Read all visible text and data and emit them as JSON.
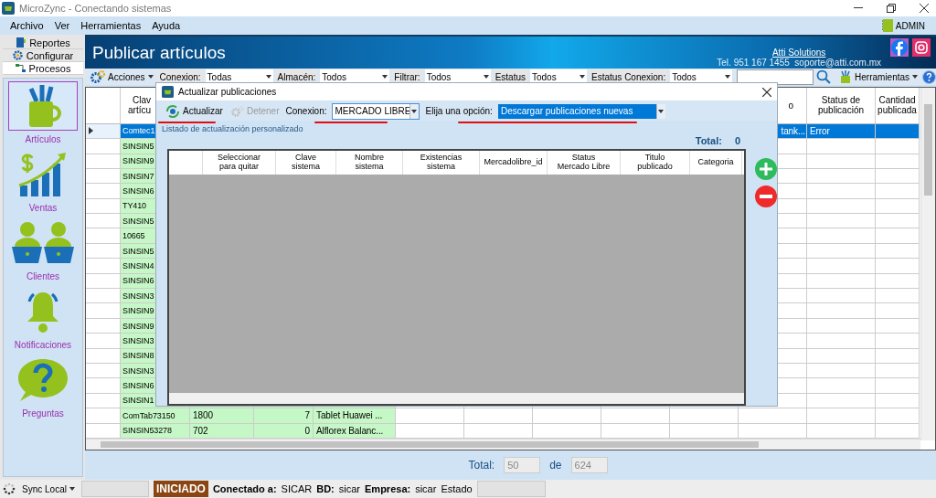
{
  "window": {
    "title": "MicroZync - Conectando sistemas"
  },
  "menu": [
    {
      "label": "Archivo"
    },
    {
      "label": "Ver"
    },
    {
      "label": "Herramientas"
    },
    {
      "label": "Ayuda"
    }
  ],
  "user": {
    "name": "ADMIN"
  },
  "sidebar": {
    "tabs": [
      {
        "label": "Reportes",
        "kind": "book",
        "selected": false
      },
      {
        "label": "Configurar",
        "kind": "gear",
        "selected": false
      },
      {
        "label": "Procesos",
        "kind": "flow",
        "selected": true
      }
    ],
    "items": [
      {
        "label": "Artículos",
        "kind": "supplies",
        "selected": true
      },
      {
        "label": "Ventas",
        "kind": "chart",
        "selected": false
      },
      {
        "label": "Clientes",
        "kind": "people",
        "selected": false
      },
      {
        "label": "Notificaciones",
        "kind": "bell",
        "selected": false
      },
      {
        "label": "Preguntas",
        "kind": "question",
        "selected": false
      }
    ]
  },
  "header": {
    "title": "Publicar artículos",
    "company": "Atti Solutions",
    "contact": "Tel. 951 167 1455  soporte@atti.com.mx"
  },
  "toolbar": {
    "actions": "Acciones",
    "filters": [
      {
        "label": "Conexion:",
        "value": "Todas"
      },
      {
        "label": "Almacén:",
        "value": "Todos"
      },
      {
        "label": "Filtrar:",
        "value": "Todos"
      },
      {
        "label": "Estatus",
        "value": "Todos"
      },
      {
        "label": "Estatus Conexion:",
        "value": "Todos"
      }
    ],
    "tools": "Herramientas"
  },
  "table": {
    "columns": {
      "clave": "Clav\nartícu",
      "column_10": "o",
      "status": "Status de\npublicación",
      "quantity": "Cantidad\npublicada"
    },
    "rows": [
      {
        "selected": true,
        "clave": "Comtec1",
        "column_10": "tank...",
        "status": "Error"
      },
      {
        "selected": false,
        "clave": "SINSIN5"
      },
      {
        "selected": false,
        "clave": "SINSIN9"
      },
      {
        "selected": false,
        "clave": "SINSIN7"
      },
      {
        "selected": false,
        "clave": "SINSIN6"
      },
      {
        "selected": false,
        "clave": "TY410"
      },
      {
        "selected": false,
        "clave": "SINSIN5"
      },
      {
        "selected": false,
        "clave": "10665"
      },
      {
        "selected": false,
        "clave": "SINSIN5"
      },
      {
        "selected": false,
        "clave": "SINSIN4"
      },
      {
        "selected": false,
        "clave": "SINSIN6"
      },
      {
        "selected": false,
        "clave": "SINSIN3"
      },
      {
        "selected": false,
        "clave": "SINSIN9"
      },
      {
        "selected": false,
        "clave": "SINSIN9"
      },
      {
        "selected": false,
        "clave": "SINSIN3"
      },
      {
        "selected": false,
        "clave": "SINSIN8"
      },
      {
        "selected": false,
        "clave": "SINSIN3"
      },
      {
        "selected": false,
        "clave": "SINSIN6"
      },
      {
        "selected": false,
        "clave": "SINSIN1"
      },
      {
        "selected": false,
        "clave": "ComTab73150",
        "column_2": "1800",
        "column_3": "7",
        "column_4": "Tablet Huawei ..."
      },
      {
        "selected": false,
        "clave": "SINSIN53278",
        "column_2": "702",
        "column_3": "0",
        "column_4": "Alflorex Balanc..."
      }
    ]
  },
  "dialog": {
    "title": "Actualizar publicaciones",
    "refresh": {
      "label": "Actualizar",
      "disabled": false
    },
    "stop": {
      "label": "Detener",
      "disabled": true
    },
    "connection": {
      "label": "Conexion:",
      "value": "MERCADO LIBRE"
    },
    "option": {
      "label": "Elija una opción:",
      "value": "Descargar publicaciones nuevas"
    },
    "group_label": "Listado de actualización personalizado",
    "total_label": "Total:",
    "total": "0",
    "columns": [
      "Seleccionar\npara quitar",
      "Clave\nsistema",
      "Nombre\nsistema",
      "Existencias\nsistema",
      "Mercadolibre_id",
      "Status\nMercado Libre",
      "Titulo\npublicado",
      "Categoria"
    ]
  },
  "footer": {
    "total_label": "Total:",
    "shown": "50",
    "of_label": "de",
    "count": "624"
  },
  "status_bar": {
    "sync": "Sync Local",
    "state": "INICIADO",
    "connected_label": "Conectado a:",
    "connected": "SICAR",
    "db_label": "BD:",
    "db": "sicar",
    "company_label": "Empresa:",
    "company": "sicar",
    "status_label": "Estado"
  }
}
